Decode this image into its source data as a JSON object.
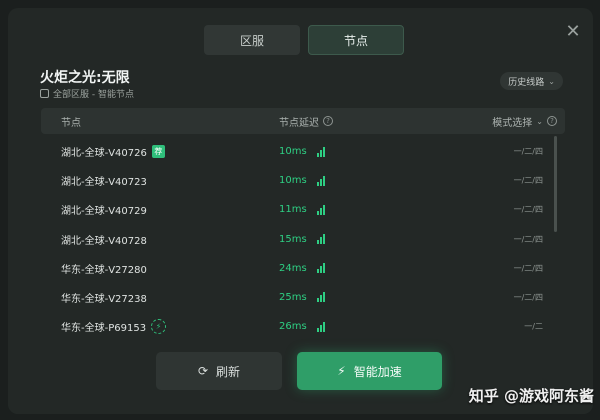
{
  "tabs": [
    {
      "label": "区服",
      "active": false
    },
    {
      "label": "节点",
      "active": true
    }
  ],
  "game_title": "火炬之光:无限",
  "subtitle": "全部区服 - 智能节点",
  "history_label": "历史线路",
  "table": {
    "col_node": "节点",
    "col_latency": "节点延迟",
    "col_mode": "模式选择"
  },
  "rows": [
    {
      "name": "湖北-全球-V40726",
      "latency": "10ms",
      "mode": "一/二/四",
      "badge": "荐"
    },
    {
      "name": "湖北-全球-V40723",
      "latency": "10ms",
      "mode": "一/二/四",
      "badge": ""
    },
    {
      "name": "湖北-全球-V40729",
      "latency": "11ms",
      "mode": "一/二/四",
      "badge": ""
    },
    {
      "name": "湖北-全球-V40728",
      "latency": "15ms",
      "mode": "一/二/四",
      "badge": ""
    },
    {
      "name": "华东-全球-V27280",
      "latency": "24ms",
      "mode": "一/二/四",
      "badge": ""
    },
    {
      "name": "华东-全球-V27238",
      "latency": "25ms",
      "mode": "一/二/四",
      "badge": ""
    },
    {
      "name": "华东-全球-P69153",
      "latency": "26ms",
      "mode": "一/二",
      "badge": "bolt"
    }
  ],
  "buttons": {
    "refresh": "刷新",
    "accelerate": "智能加速"
  },
  "watermark": "知乎 @游戏阿东酱",
  "colors": {
    "accent": "#2fbf7b",
    "latency_text": "#2ecf83",
    "accelerate_bg": "#2f9e68"
  }
}
